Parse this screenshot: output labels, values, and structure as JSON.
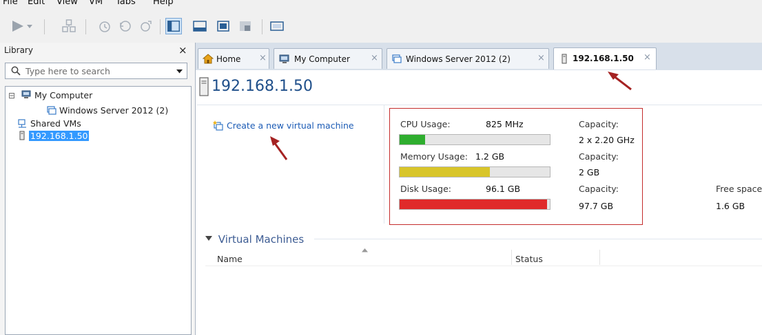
{
  "menu": [
    "File",
    "Edit",
    "View",
    "VM",
    "Tabs",
    "Help"
  ],
  "library": {
    "title": "Library",
    "close": "×",
    "search_placeholder": "Type here to search",
    "tree": [
      {
        "label": "My Computer",
        "expander": "⊟"
      },
      {
        "label": "Windows Server 2012 (2)"
      },
      {
        "label": "Shared VMs"
      },
      {
        "label": "192.168.1.50",
        "selected": true
      }
    ]
  },
  "tabs": [
    {
      "label": "Home",
      "close": "×"
    },
    {
      "label": "My Computer",
      "close": "×"
    },
    {
      "label": "Windows Server 2012 (2)",
      "close": "×"
    },
    {
      "label": "192.168.1.50",
      "close": "×",
      "active": true
    }
  ],
  "page": {
    "title": "192.168.1.50",
    "create_link": "Create a new virtual machine"
  },
  "resources": {
    "cpu": {
      "label": "CPU Usage:",
      "value": "825 MHz",
      "capacity_label": "Capacity:",
      "capacity": "2 x 2.20 GHz",
      "fill_fraction": 0.17,
      "color": "#2fae2f"
    },
    "memory": {
      "label": "Memory Usage:",
      "value": "1.2 GB",
      "capacity_label": "Capacity:",
      "capacity": "2 GB",
      "fill_fraction": 0.6,
      "color": "#d8c52a"
    },
    "disk": {
      "label": "Disk Usage:",
      "value": "96.1 GB",
      "capacity_label": "Capacity:",
      "capacity": "97.7 GB",
      "free_label": "Free space",
      "free": "1.6 GB",
      "fill_fraction": 0.98,
      "color": "#e02a2a"
    }
  },
  "virtual_machines": {
    "header": "Virtual Machines",
    "columns": [
      "Name",
      "Status"
    ]
  },
  "colors": {
    "accent": "#1f4f8a",
    "highlight_box": "#c42c2c",
    "selection": "#3399ff"
  }
}
